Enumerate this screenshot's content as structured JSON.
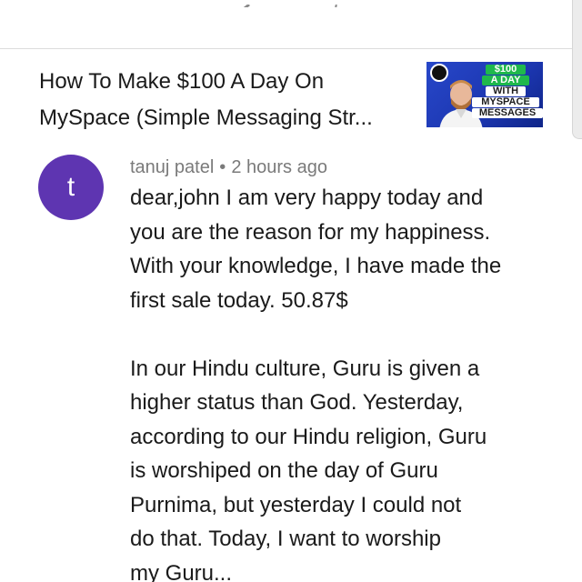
{
  "video": {
    "title_line1": "How To Make $100 A Day On",
    "title_line2": "MySpace (Simple Messaging Str...",
    "thumbnail": {
      "line1": "$100",
      "line2": "A DAY",
      "line3": "WITH",
      "line4": "MYSPACE",
      "line5": "MESSAGES"
    }
  },
  "comment": {
    "avatar_letter": "t",
    "author": "tanuj patel",
    "separator": "•",
    "time": "2 hours ago",
    "lines_p1": [
      "dear,john I am very happy today and",
      "you are the reason for my happiness.",
      "With your knowledge, I have made the",
      "first sale today. 50.87$"
    ],
    "lines_p2": [
      "In our Hindu culture, Guru is given a",
      "higher status than God. Yesterday,",
      "according to our Hindu religion, Guru",
      "is worshiped on the day of Guru",
      "Purnima, but yesterday I could not",
      "do that. Today, I want to worship",
      "my Guru..."
    ]
  },
  "colors": {
    "avatar_bg": "#5e35b1",
    "thumb_bg": "#2747c9",
    "thumb_accent": "#1fb84c",
    "meta_text": "#7a7a7a"
  }
}
